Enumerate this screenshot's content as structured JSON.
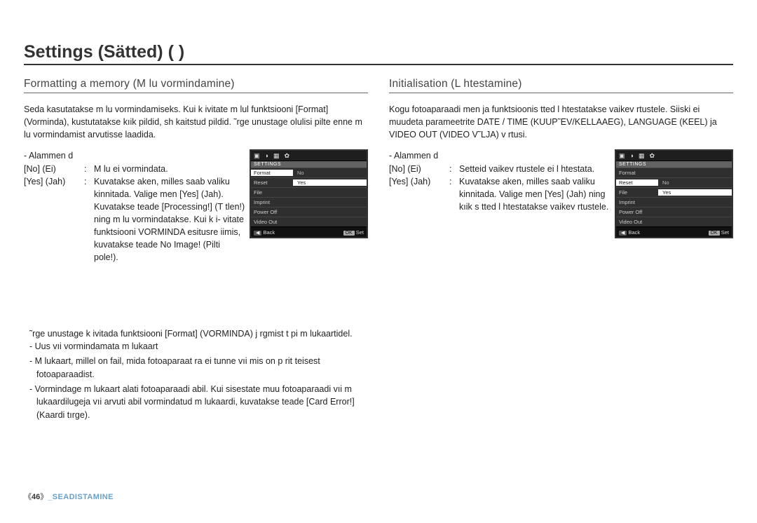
{
  "page": {
    "title": "Settings (Sätted) (        )"
  },
  "left": {
    "heading": "Formatting a memory (M  lu vormindamine)",
    "intro": "Seda kasutatakse m  lu vormindamiseks. Kui k  ivitate m  lul funktsiooni [Format] (Vorminda), kustutatakse kıik pildid, sh kaitstud pildid. ˜rge unustage olulisi pilte enne m  lu vormindamist arvutisse laadida.",
    "sub_title": "- Alammen    d",
    "opt_no_key": "[No] (Ei)",
    "opt_no_val": "M  lu ei vormindata.",
    "opt_yes_key": "[Yes] (Jah)",
    "opt_yes_val": "Kuvatakse aken, milles saab valiku kinnitada. Valige men    [Yes] (Jah). Kuvatakse teade [Processing!] (T    tlen!) ning m  lu vormindatakse. Kui k  i- vitate funktsiooni VORMINDA esitusre iimis, kuvatakse teade No Image! (Pilti pole!).",
    "notes_intro": "˜rge unustage k  ivitada funktsiooni [Format] (VORMINDA) j  rgmist t    pi m  lukaartidel.",
    "note1": "- Uus vıi vormindamata m  lukaart",
    "note2": "- M  lukaart, millel on fail, mida fotoaparaat  ra ei tunne vıi mis on p  rit teisest fotoaparaadist.",
    "note3": "- Vormindage m  lukaart alati fotoaparaadi abil. Kui sisestate muu fotoaparaadi vıi m  lukaardilugeja vıi arvuti abil vormindatud m  lukaardi, kuvatakse teade [Card Error!] (Kaardi tırge)."
  },
  "right": {
    "heading": "Initialisation (L  htestamine)",
    "intro": "Kogu fotoaparaadi men    ja funktsioonis  tted l  htestatakse vaikev    rtustele. Siiski ei muudeta parameetrite DATE / TIME (KUUP˜EV/KELLAAEG), LANGUAGE (KEEL) ja VIDEO OUT (VIDEO V˜LJA) v    rtusi.",
    "sub_title": "- Alammen    d",
    "opt_no_key": "[No] (Ei)",
    "opt_no_val": "Setteid vaikev    rtustele ei l  htestata.",
    "opt_yes_key": "[Yes] (Jah)",
    "opt_yes_val": "Kuvatakse aken, milles saab valiku kinnitada. Valige men    [Yes] (Jah) ning kıik s  tted l  htestatakse vaikev    rtustele."
  },
  "lcd_left": {
    "icons": [
      "▣",
      "◑",
      "▦",
      "✿"
    ],
    "banner": "SETTINGS",
    "rows": [
      {
        "l": "Format",
        "r": "No",
        "sel": true,
        "ractive": false
      },
      {
        "l": "Reset",
        "r": "Yes",
        "sel": false,
        "ractive": true
      },
      {
        "l": "File",
        "r": "",
        "sel": false,
        "ractive": false
      },
      {
        "l": "Imprint",
        "r": "",
        "sel": false,
        "ractive": false
      },
      {
        "l": "Power Off",
        "r": "",
        "sel": false,
        "ractive": false
      },
      {
        "l": "Video Out",
        "r": "",
        "sel": false,
        "ractive": false
      }
    ],
    "foot_back_btn": "◀",
    "foot_back": "Back",
    "foot_ok_btn": "OK",
    "foot_ok": "Set"
  },
  "lcd_right": {
    "icons": [
      "▣",
      "◑",
      "▦",
      "✿"
    ],
    "banner": "SETTINGS",
    "rows": [
      {
        "l": "Format",
        "r": "",
        "sel": false,
        "ractive": false
      },
      {
        "l": "Reset",
        "r": "No",
        "sel": true,
        "ractive": false
      },
      {
        "l": "File",
        "r": "Yes",
        "sel": false,
        "ractive": true
      },
      {
        "l": "Imprint",
        "r": "",
        "sel": false,
        "ractive": false
      },
      {
        "l": "Power Off",
        "r": "",
        "sel": false,
        "ractive": false
      },
      {
        "l": "Video Out",
        "r": "",
        "sel": false,
        "ractive": false
      }
    ],
    "foot_back_btn": "◀",
    "foot_back": "Back",
    "foot_ok_btn": "OK",
    "foot_ok": "Set"
  },
  "footer": {
    "page_open": "《",
    "page_num": "46",
    "page_close": "》",
    "section": "_SEADISTAMINE"
  }
}
